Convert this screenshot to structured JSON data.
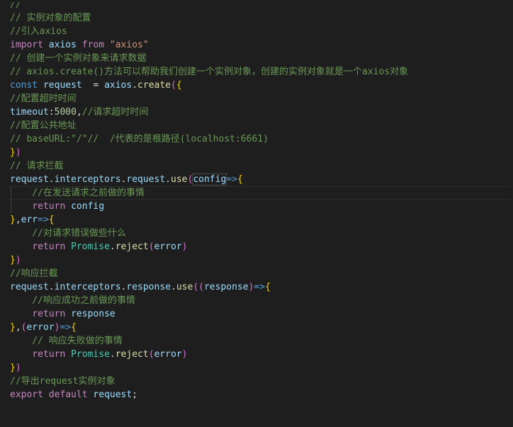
{
  "editor": {
    "background": "#1e1e1e",
    "lines": [
      {
        "clip": true,
        "tokens": [
          {
            "t": "//    ",
            "c": "comment"
          }
        ]
      },
      {
        "tokens": [
          {
            "t": "// 实例对象的配置",
            "c": "comment"
          }
        ]
      },
      {
        "tokens": [
          {
            "t": "//引入axios",
            "c": "comment"
          }
        ]
      },
      {
        "tokens": [
          {
            "t": "import",
            "c": "keyword"
          },
          {
            "t": " ",
            "c": "plain"
          },
          {
            "t": "axios",
            "c": "var"
          },
          {
            "t": " ",
            "c": "plain"
          },
          {
            "t": "from",
            "c": "keyword"
          },
          {
            "t": " ",
            "c": "plain"
          },
          {
            "t": "\"axios\"",
            "c": "string"
          }
        ]
      },
      {
        "tokens": [
          {
            "t": "// 创建一个实例对象来请求数据",
            "c": "comment"
          }
        ]
      },
      {
        "tokens": [
          {
            "t": "// axios.create()方法可以帮助我们创建一个实例对象，创建的实例对象就是一个axios对象",
            "c": "comment"
          }
        ]
      },
      {
        "tokens": [
          {
            "t": "const",
            "c": "storage"
          },
          {
            "t": " ",
            "c": "plain"
          },
          {
            "t": "request",
            "c": "var"
          },
          {
            "t": "  = ",
            "c": "op"
          },
          {
            "t": "axios",
            "c": "var"
          },
          {
            "t": ".",
            "c": "plain"
          },
          {
            "t": "create",
            "c": "func"
          },
          {
            "t": "(",
            "c": "paren"
          },
          {
            "t": "{",
            "c": "brace"
          }
        ]
      },
      {
        "tokens": [
          {
            "t": "//配置超时时间",
            "c": "comment"
          }
        ]
      },
      {
        "tokens": [
          {
            "t": "timeout",
            "c": "var"
          },
          {
            "t": ":",
            "c": "plain"
          },
          {
            "t": "5000",
            "c": "number"
          },
          {
            "t": ",",
            "c": "plain"
          },
          {
            "t": "//请求超时时间",
            "c": "comment"
          }
        ]
      },
      {
        "tokens": [
          {
            "t": "//配置公共地址",
            "c": "comment"
          }
        ]
      },
      {
        "tokens": [
          {
            "t": "// baseURL:\"/\"//  /代表的是根路径(localhost:6661)",
            "c": "comment"
          }
        ]
      },
      {
        "tokens": [
          {
            "t": "}",
            "c": "brace"
          },
          {
            "t": ")",
            "c": "paren"
          }
        ]
      },
      {
        "tokens": [
          {
            "t": "// 请求拦截",
            "c": "comment"
          }
        ]
      },
      {
        "tokens": [
          {
            "t": "request",
            "c": "var"
          },
          {
            "t": ".",
            "c": "plain"
          },
          {
            "t": "interceptors",
            "c": "var"
          },
          {
            "t": ".",
            "c": "plain"
          },
          {
            "t": "request",
            "c": "var"
          },
          {
            "t": ".",
            "c": "plain"
          },
          {
            "t": "use",
            "c": "func"
          },
          {
            "t": "(",
            "c": "paren"
          },
          {
            "t": "config",
            "c": "var",
            "sel": true
          },
          {
            "t": "=>",
            "c": "arrow"
          },
          {
            "t": "{",
            "c": "brace"
          }
        ]
      },
      {
        "active": true,
        "guide": true,
        "tokens": [
          {
            "t": "    //在发送请求之前做的事情",
            "c": "comment"
          }
        ]
      },
      {
        "guide": true,
        "tokens": [
          {
            "t": "    ",
            "c": "plain"
          },
          {
            "t": "return",
            "c": "keyword"
          },
          {
            "t": " ",
            "c": "plain"
          },
          {
            "t": "config",
            "c": "var"
          }
        ]
      },
      {
        "tokens": [
          {
            "t": "}",
            "c": "brace"
          },
          {
            "t": ",",
            "c": "plain"
          },
          {
            "t": "err",
            "c": "var"
          },
          {
            "t": "=>",
            "c": "arrow"
          },
          {
            "t": "{",
            "c": "brace"
          }
        ]
      },
      {
        "tokens": [
          {
            "t": "    //对请求错误做些什么",
            "c": "comment"
          }
        ]
      },
      {
        "tokens": [
          {
            "t": "    ",
            "c": "plain"
          },
          {
            "t": "return",
            "c": "keyword"
          },
          {
            "t": " ",
            "c": "plain"
          },
          {
            "t": "Promise",
            "c": "class"
          },
          {
            "t": ".",
            "c": "plain"
          },
          {
            "t": "reject",
            "c": "func"
          },
          {
            "t": "(",
            "c": "paren"
          },
          {
            "t": "error",
            "c": "var"
          },
          {
            "t": ")",
            "c": "paren"
          }
        ]
      },
      {
        "tokens": [
          {
            "t": "}",
            "c": "brace"
          },
          {
            "t": ")",
            "c": "paren"
          }
        ]
      },
      {
        "tokens": [
          {
            "t": "//响应拦截",
            "c": "comment"
          }
        ]
      },
      {
        "tokens": [
          {
            "t": "request",
            "c": "var"
          },
          {
            "t": ".",
            "c": "plain"
          },
          {
            "t": "interceptors",
            "c": "var"
          },
          {
            "t": ".",
            "c": "plain"
          },
          {
            "t": "response",
            "c": "var"
          },
          {
            "t": ".",
            "c": "plain"
          },
          {
            "t": "use",
            "c": "func"
          },
          {
            "t": "(",
            "c": "paren"
          },
          {
            "t": "(",
            "c": "paren"
          },
          {
            "t": "response",
            "c": "var"
          },
          {
            "t": ")",
            "c": "paren"
          },
          {
            "t": "=>",
            "c": "arrow"
          },
          {
            "t": "{",
            "c": "brace"
          }
        ]
      },
      {
        "tokens": [
          {
            "t": "    //响应成功之前做的事情",
            "c": "comment"
          }
        ]
      },
      {
        "tokens": [
          {
            "t": "    ",
            "c": "plain"
          },
          {
            "t": "return",
            "c": "keyword"
          },
          {
            "t": " ",
            "c": "plain"
          },
          {
            "t": "response",
            "c": "var"
          }
        ]
      },
      {
        "tokens": [
          {
            "t": "}",
            "c": "brace"
          },
          {
            "t": ",",
            "c": "plain"
          },
          {
            "t": "(",
            "c": "paren"
          },
          {
            "t": "error",
            "c": "var"
          },
          {
            "t": ")",
            "c": "paren"
          },
          {
            "t": "=>",
            "c": "arrow"
          },
          {
            "t": "{",
            "c": "brace"
          }
        ]
      },
      {
        "tokens": [
          {
            "t": "    // 响应失败做的事情",
            "c": "comment"
          }
        ]
      },
      {
        "tokens": [
          {
            "t": "    ",
            "c": "plain"
          },
          {
            "t": "return",
            "c": "keyword"
          },
          {
            "t": " ",
            "c": "plain"
          },
          {
            "t": "Promise",
            "c": "class"
          },
          {
            "t": ".",
            "c": "plain"
          },
          {
            "t": "reject",
            "c": "func"
          },
          {
            "t": "(",
            "c": "paren"
          },
          {
            "t": "error",
            "c": "var"
          },
          {
            "t": ")",
            "c": "paren"
          }
        ]
      },
      {
        "tokens": [
          {
            "t": "}",
            "c": "brace"
          },
          {
            "t": ")",
            "c": "paren"
          }
        ]
      },
      {
        "tokens": [
          {
            "t": "//导出request实例对象",
            "c": "comment"
          }
        ]
      },
      {
        "tokens": [
          {
            "t": "export",
            "c": "keyword"
          },
          {
            "t": " ",
            "c": "plain"
          },
          {
            "t": "default",
            "c": "keyword"
          },
          {
            "t": " ",
            "c": "plain"
          },
          {
            "t": "request",
            "c": "var"
          },
          {
            "t": ";",
            "c": "plain"
          }
        ]
      }
    ]
  }
}
